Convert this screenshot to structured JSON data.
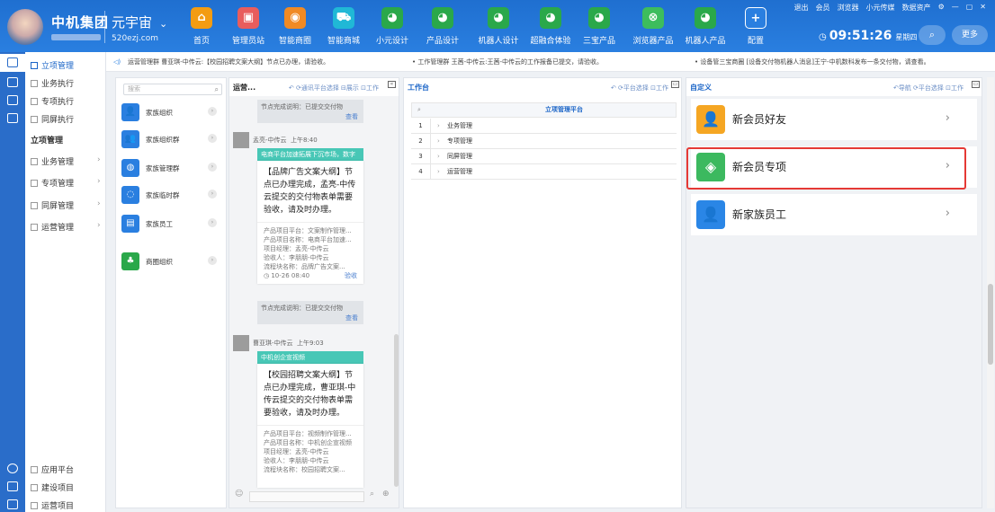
{
  "app": {
    "brand": "中机集团",
    "universe": "元宇宙",
    "site": "520ezj.com"
  },
  "nav": [
    {
      "label": "首页",
      "icon": "home-icon",
      "color": "#f39c12",
      "glyph": "⌂"
    },
    {
      "label": "管理员站",
      "icon": "admin-icon",
      "color": "#e85d5d",
      "glyph": "▣"
    },
    {
      "label": "智能商圈",
      "icon": "shop-circle-icon",
      "color": "#f08a24",
      "glyph": "◉"
    },
    {
      "label": "智能商城",
      "icon": "cart-icon",
      "color": "#20b8d6",
      "glyph": "⛟"
    },
    {
      "label": "小元设计",
      "icon": "globe-icon",
      "color": "#2aa84a",
      "glyph": "◕"
    },
    {
      "label": "产品设计",
      "icon": "globe-icon",
      "color": "#2aa84a",
      "glyph": "◕"
    },
    {
      "label": "机器人设计",
      "icon": "globe-icon",
      "color": "#2aa84a",
      "glyph": "◕"
    },
    {
      "label": "超融合体验",
      "icon": "globe-icon",
      "color": "#2aa84a",
      "glyph": "◕"
    },
    {
      "label": "三宝产品",
      "icon": "globe-icon",
      "color": "#2aa84a",
      "glyph": "◕"
    },
    {
      "label": "浏览器产品",
      "icon": "browser-icon",
      "color": "#3dbd5d",
      "glyph": "⊗"
    },
    {
      "label": "机器人产品",
      "icon": "globe-icon",
      "color": "#2aa84a",
      "glyph": "◕"
    },
    {
      "label": "配置",
      "icon": "plus-icon",
      "color": "#2a7fe0",
      "glyph": "+"
    }
  ],
  "topright": [
    "退出",
    "会员",
    "浏览器",
    "小元传媒",
    "数据资产",
    "⚙",
    "—",
    "▢",
    "✕"
  ],
  "clock": {
    "time": "09:51:26",
    "weekday": "星期四",
    "more": "更多"
  },
  "sidebar": {
    "top": [
      {
        "label": "立项管理",
        "active": true
      },
      {
        "label": "业务执行"
      },
      {
        "label": "专项执行"
      },
      {
        "label": "同屏执行"
      }
    ],
    "section": "立项管理",
    "sub": [
      {
        "label": "业务管理"
      },
      {
        "label": "专项管理"
      },
      {
        "label": "同屏管理"
      },
      {
        "label": "运营管理"
      }
    ],
    "bottom": [
      {
        "label": "应用平台"
      },
      {
        "label": "建设项目"
      },
      {
        "label": "运营项目"
      }
    ]
  },
  "notice": [
    "运营管理群 曹亚琪-中传云:【校园招聘文案大纲】节点已办理，请验收。",
    "• 工作管理群 王茜-中传云:王茜-中传云的工作报备已提交，请验收。",
    "• 设备管三宝商圈 [设备交付物机器人消息]王宁-中机数科发布一条交付物，请查看。"
  ],
  "groups": {
    "search_placeholder": "搜索",
    "items": [
      {
        "label": "家族组织",
        "color": "#2a7fe0",
        "icon": "user-icon",
        "glyph": "👤"
      },
      {
        "label": "家族组织群",
        "color": "#2a7fe0",
        "icon": "group-icon",
        "glyph": "👥"
      },
      {
        "label": "家族管理群",
        "color": "#2a7fe0",
        "icon": "chat-icon",
        "glyph": "◍"
      },
      {
        "label": "家族临时群",
        "color": "#2a7fe0",
        "icon": "temp-group-icon",
        "glyph": "◌"
      },
      {
        "label": "家族员工",
        "color": "#2a7fe0",
        "icon": "badge-icon",
        "glyph": "▤"
      },
      {
        "label": "商圈组织",
        "color": "#2aa84a",
        "icon": "org-icon",
        "glyph": "♣"
      }
    ]
  },
  "chat": {
    "title": "运营...",
    "actions": "↶ ⟳通讯平台选择  ⊟展示  ⊡工作",
    "done1": "节点完成说明：已提交交付物",
    "view": "查看",
    "msg1": {
      "sender": "孟亮-中传云",
      "time": "上午8:40",
      "bar": "电商平台加速拓展下沉市场，数字",
      "text": "【品牌广告文案大纲】节点已办理完成，孟亮-中传云提交的交付物表单需要验收，请及时办理。",
      "meta": [
        "产品项目平台：文案制作管理...",
        "产品项目名称：电商平台加速...",
        "项目经理：孟亮-中传云",
        "验收人：李朋朋-中传云",
        "流程块名称：品牌广告文案..."
      ],
      "stamp": "10-26 08:40",
      "accept": "验收"
    },
    "done2": "节点完成说明：已提交交付物",
    "msg2": {
      "sender": "曹亚琪-中传云",
      "time": "上午9:03",
      "bar": "中机创企宣视频",
      "text": "【校园招聘文案大纲】节点已办理完成，曹亚琪-中传云提交的交付物表单需要验收，请及时办理。",
      "meta": [
        "产品项目平台：视频制作管理...",
        "产品项目名称：中机创企宣视频",
        "项目经理：孟亮-中传云",
        "验收人：李朋朋-中传云",
        "流程块名称：校园招聘文案..."
      ]
    }
  },
  "worktable": {
    "title": "工作台",
    "actions": "↶ ⟳平台选择  ⊡工作",
    "header": "立项管理平台",
    "rows": [
      {
        "n": "1",
        "label": "业务管理"
      },
      {
        "n": "2",
        "label": "专项管理"
      },
      {
        "n": "3",
        "label": "同屏管理"
      },
      {
        "n": "4",
        "label": "运营管理"
      }
    ]
  },
  "custom": {
    "title": "自定义",
    "actions": "↶导航  ⟳平台选择  ⊡工作",
    "items": [
      {
        "label": "新会员好友",
        "color": "#f5a623",
        "icon": "member-friend-icon",
        "glyph": "👤"
      },
      {
        "label": "新会员专项",
        "color": "#3cb95f",
        "icon": "member-special-icon",
        "glyph": "◈"
      },
      {
        "label": "新家族员工",
        "color": "#2a86e6",
        "icon": "family-staff-icon",
        "glyph": "👤"
      }
    ]
  }
}
